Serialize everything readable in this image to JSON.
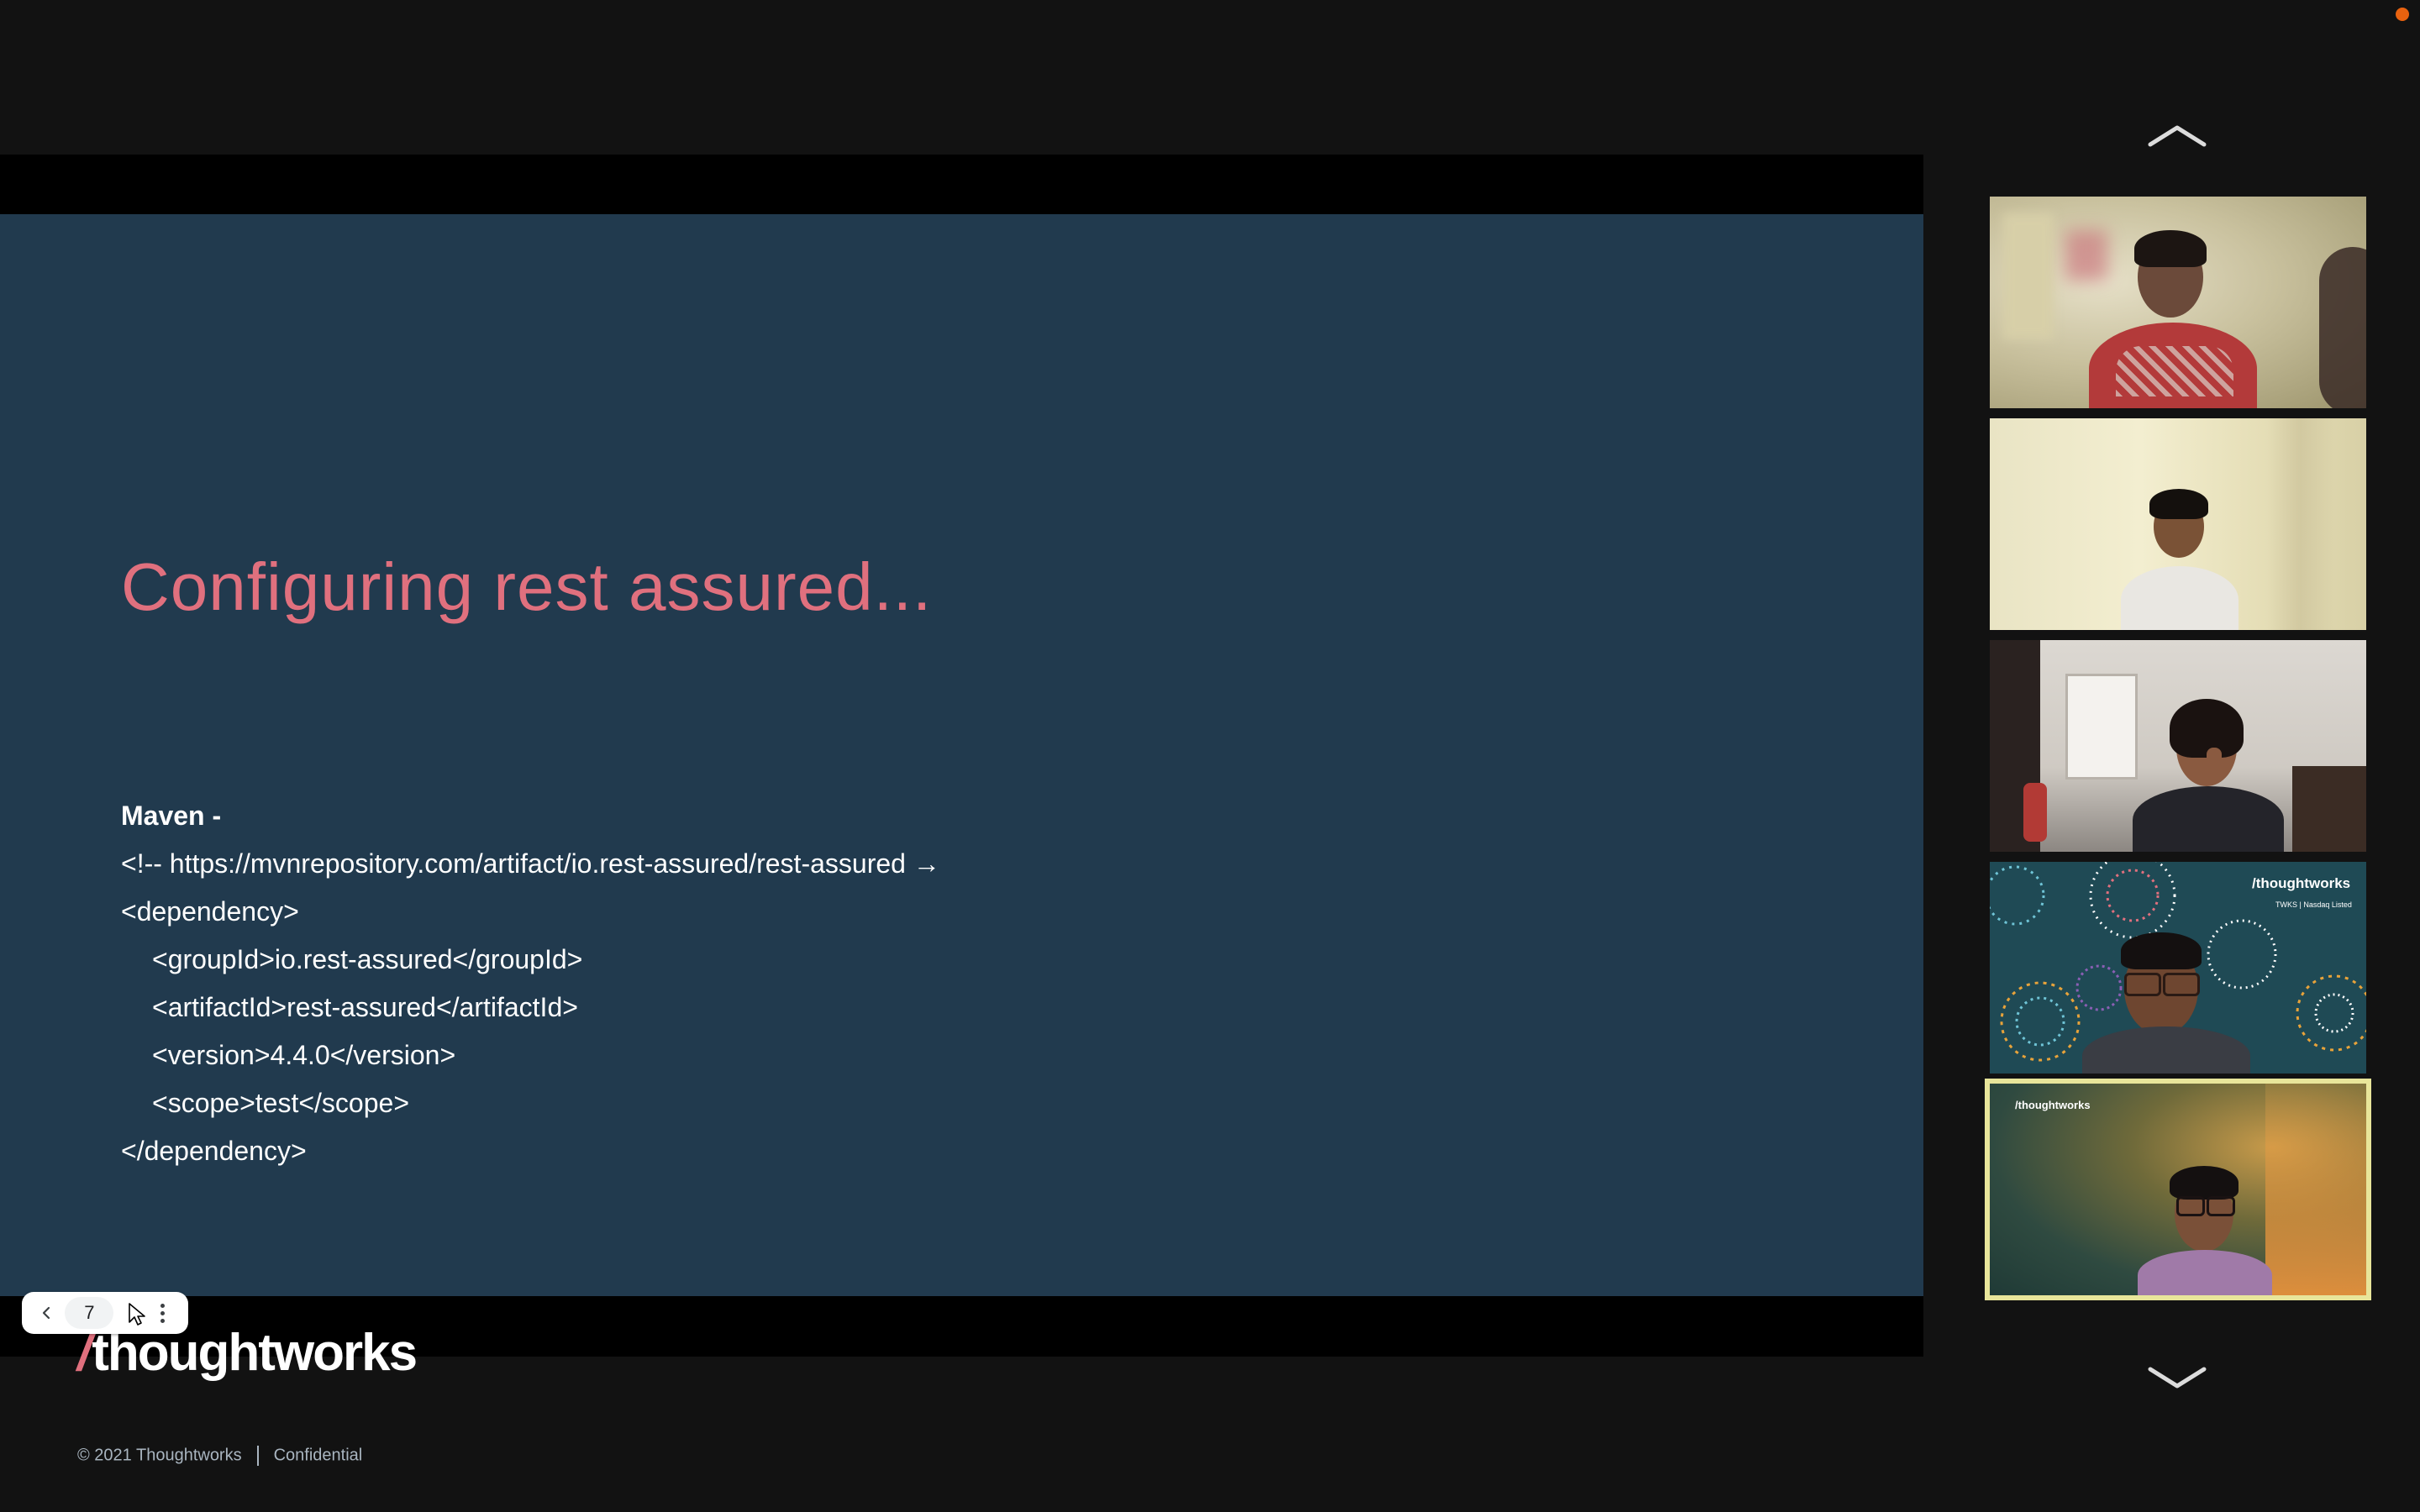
{
  "slide": {
    "title": "Configuring rest assured...",
    "body": {
      "heading": "Maven -",
      "lines": [
        "<!-- https://mvnrepository.com/artifact/io.rest-assured/rest-assured →",
        "<dependency>",
        "<groupId>io.rest-assured</groupId>",
        "<artifactId>rest-assured</artifactId>",
        "<version>4.4.0</version>",
        "<scope>test</scope>",
        "</dependency>"
      ]
    },
    "logo_text": "thoughtworks",
    "logo_slash": "/",
    "footer": {
      "copyright": "© 2021 Thoughtworks",
      "label": "Confidential"
    },
    "colors": {
      "slide_bg": "#213a4e",
      "title": "#e0707e"
    }
  },
  "slide_nav": {
    "prev_icon": "chevron-left-icon",
    "page_number": "7",
    "next_icon": "chevron-right-icon",
    "more_icon": "more-vertical-icon"
  },
  "participants": {
    "scroll_up_icon": "chevron-up-icon",
    "scroll_down_icon": "chevron-down-icon",
    "tiles": [
      {
        "id": "participant-1",
        "active": false
      },
      {
        "id": "participant-2",
        "active": false
      },
      {
        "id": "participant-3",
        "active": false
      },
      {
        "id": "participant-4",
        "active": false,
        "background_brand": "/thoughtworks",
        "background_sub": "TWKS | Nasdaq Listed"
      },
      {
        "id": "participant-5",
        "active": true,
        "background_brand": "/thoughtworks"
      }
    ],
    "active_color": "#e8e59a"
  },
  "recording_indicator_color": "#e8620f"
}
